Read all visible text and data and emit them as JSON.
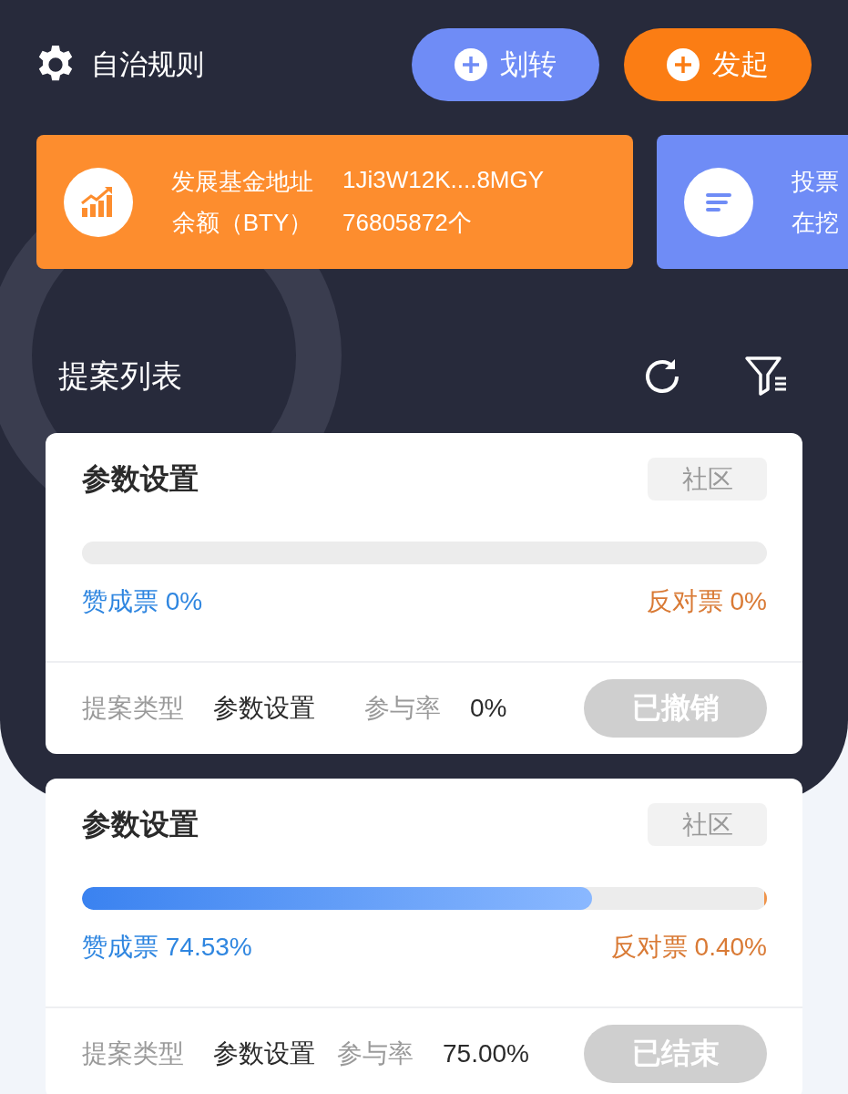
{
  "header": {
    "title": "自治规则",
    "buttons": [
      {
        "label": "划转",
        "kind": "transfer"
      },
      {
        "label": "发起",
        "kind": "launch"
      }
    ]
  },
  "info_cards": [
    {
      "kind": "fund",
      "rows": [
        {
          "label": "发展基金地址",
          "value": "1Ji3W12K....8MGY"
        },
        {
          "label": "余额（BTY）",
          "value": "76805872个"
        }
      ]
    },
    {
      "kind": "vote",
      "rows": [
        {
          "label": "投票"
        },
        {
          "label": "在挖"
        }
      ]
    }
  ],
  "section": {
    "title": "提案列表"
  },
  "proposals": [
    {
      "title": "参数设置",
      "tag": "社区",
      "approve": {
        "label": "赞成票 0%",
        "level": 0
      },
      "against": {
        "label": "反对票 0%",
        "level": 0
      },
      "type_label": "提案类型",
      "type_value": "参数设置",
      "rate_label": "参与率",
      "rate_value": "0%",
      "status": "已撤销"
    },
    {
      "title": "参数设置",
      "tag": "社区",
      "approve": {
        "label": "赞成票 74.53%",
        "level": 0.7453
      },
      "against": {
        "label": "反对票 0.40%",
        "level": 0.004
      },
      "type_label": "提案类型",
      "type_value": "参数设置",
      "rate_label": "参与率",
      "rate_value": "75.00%",
      "status": "已结束"
    }
  ]
}
